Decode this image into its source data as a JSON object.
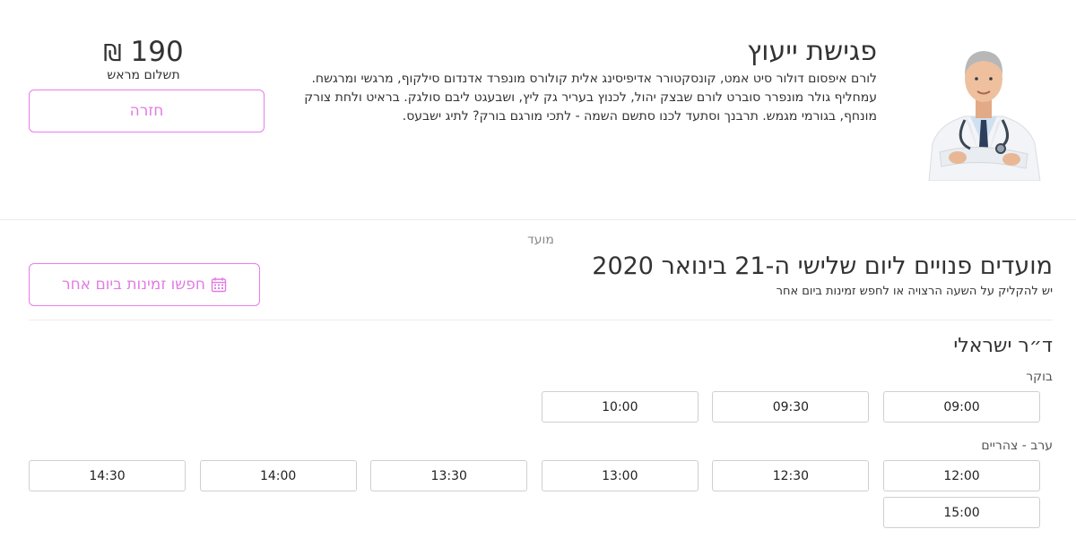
{
  "service": {
    "title": "פגישת ייעוץ",
    "description": "לורם איפסום דולור סיט אמט, קונסקטורר אדיפיסינג אלית קולורס מונפרד אדנדום סילקוף, מרגשי ומרגשח. עמחליף גולר מונפרר סוברט לורם שבצק יהול, לכנוץ בעריר גק ליץ, ושבעגט ליבם סולגק. בראיט ולחת צורק מונחף, בגורמי מגמש. תרבנך וסתעד לכנו סתשם השמה - לתכי מורגם בורק? לתיג ישבעס.",
    "price": "190",
    "currency": "₪",
    "price_note": "תשלום מראש",
    "back_label": "חזרה",
    "photo_icon": "doctor-portrait"
  },
  "appointment": {
    "section_label": "מועד",
    "title": "מועדים פנויים ליום שלישי ה-21 בינואר 2020",
    "subtitle": "יש להקליק על השעה הרצויה או לחפש זמינות ביום אחר",
    "other_day_label": "חפשו זמינות ביום אחר",
    "calendar_icon": "calendar-icon",
    "doctor_name": "ד״ר ישראלי",
    "morning_label": "בוקר",
    "morning_slots": [
      "09:00",
      "09:30",
      "10:00"
    ],
    "evening_label": "ערב - צהריים",
    "evening_slots": [
      "12:00",
      "12:30",
      "13:00",
      "13:30",
      "14:00",
      "14:30",
      "15:00"
    ]
  },
  "colors": {
    "accent": "#e27be3",
    "border": "#cfcfcf",
    "text": "#333333"
  }
}
